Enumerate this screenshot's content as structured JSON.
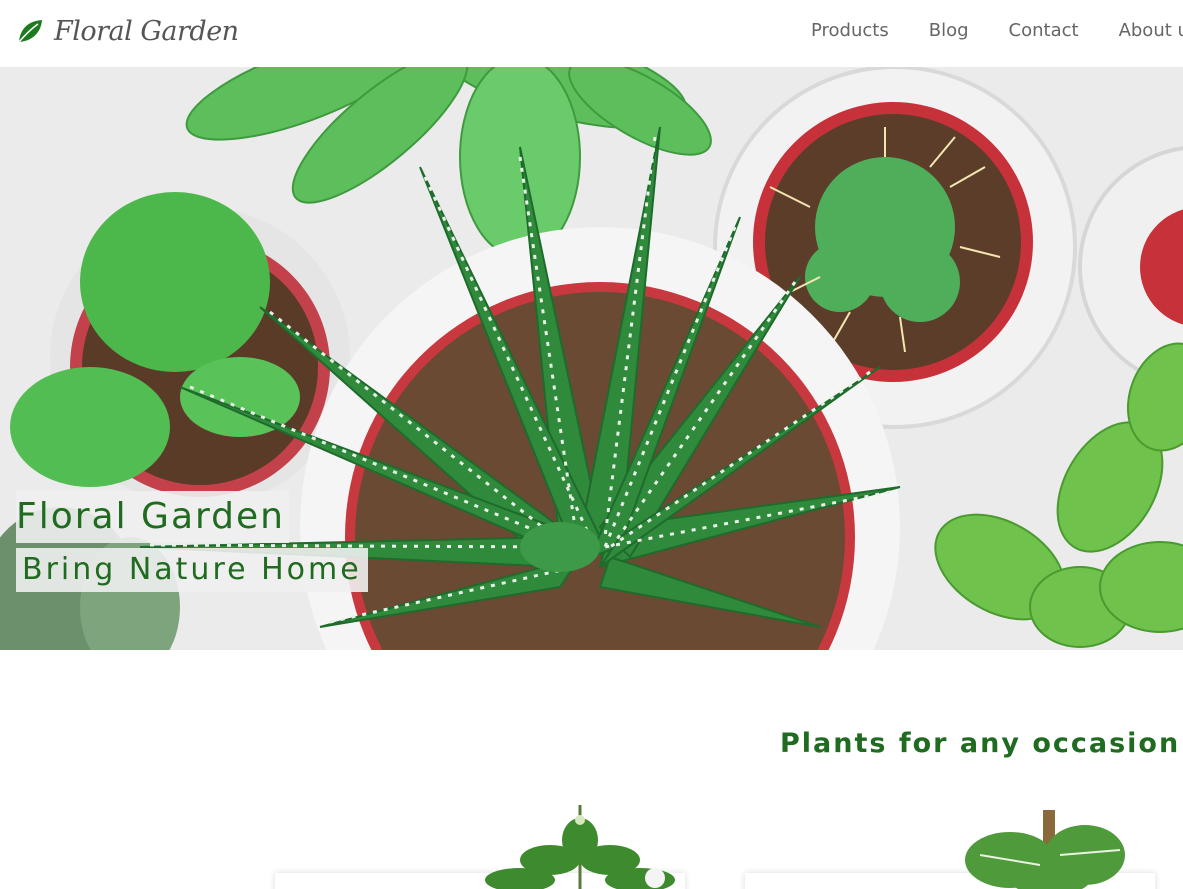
{
  "brand": {
    "name": "Floral Garden",
    "logo_icon": "leaf-icon",
    "accent_color": "#1f6b1f"
  },
  "nav": {
    "items": [
      {
        "label": "Products"
      },
      {
        "label": "Blog"
      },
      {
        "label": "Contact"
      },
      {
        "label": "About us"
      }
    ]
  },
  "hero": {
    "title": "Floral Garden",
    "subtitle": "Bring Nature Home"
  },
  "occasion": {
    "title": "Plants for any occasion"
  }
}
